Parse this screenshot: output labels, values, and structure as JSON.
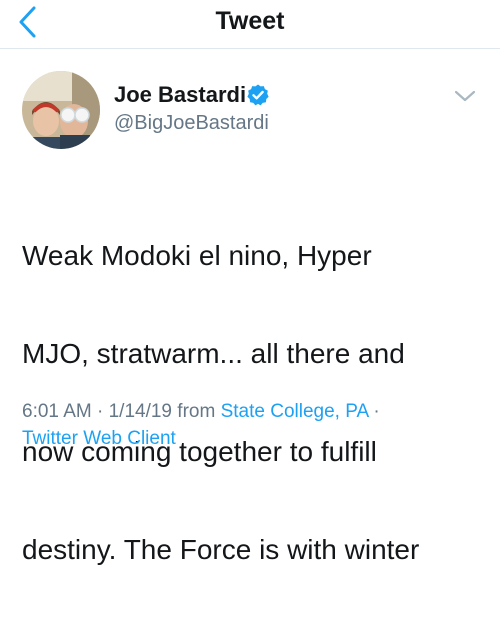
{
  "header": {
    "title": "Tweet"
  },
  "tweet": {
    "author_name": "Joe Bastardi",
    "author_handle": "@BigJoeBastardi",
    "verified": true,
    "text_lines": [
      "Weak Modoki el nino,  Hyper",
      "MJO, stratwarm... all there and",
      "now coming together to fulfill",
      "destiny.  The Force is with winter"
    ],
    "time": "6:01 AM",
    "date": "1/14/19",
    "from_label": "from",
    "location": "State College, PA",
    "client": "Twitter Web Client",
    "separator": "·"
  },
  "icons": {
    "back": "chevron-left-icon",
    "verified": "verified-badge-icon",
    "more": "chevron-down-icon"
  },
  "colors": {
    "accent": "#1da1f2",
    "text": "#14171a",
    "muted": "#657786",
    "divider": "#e1e8ed"
  }
}
